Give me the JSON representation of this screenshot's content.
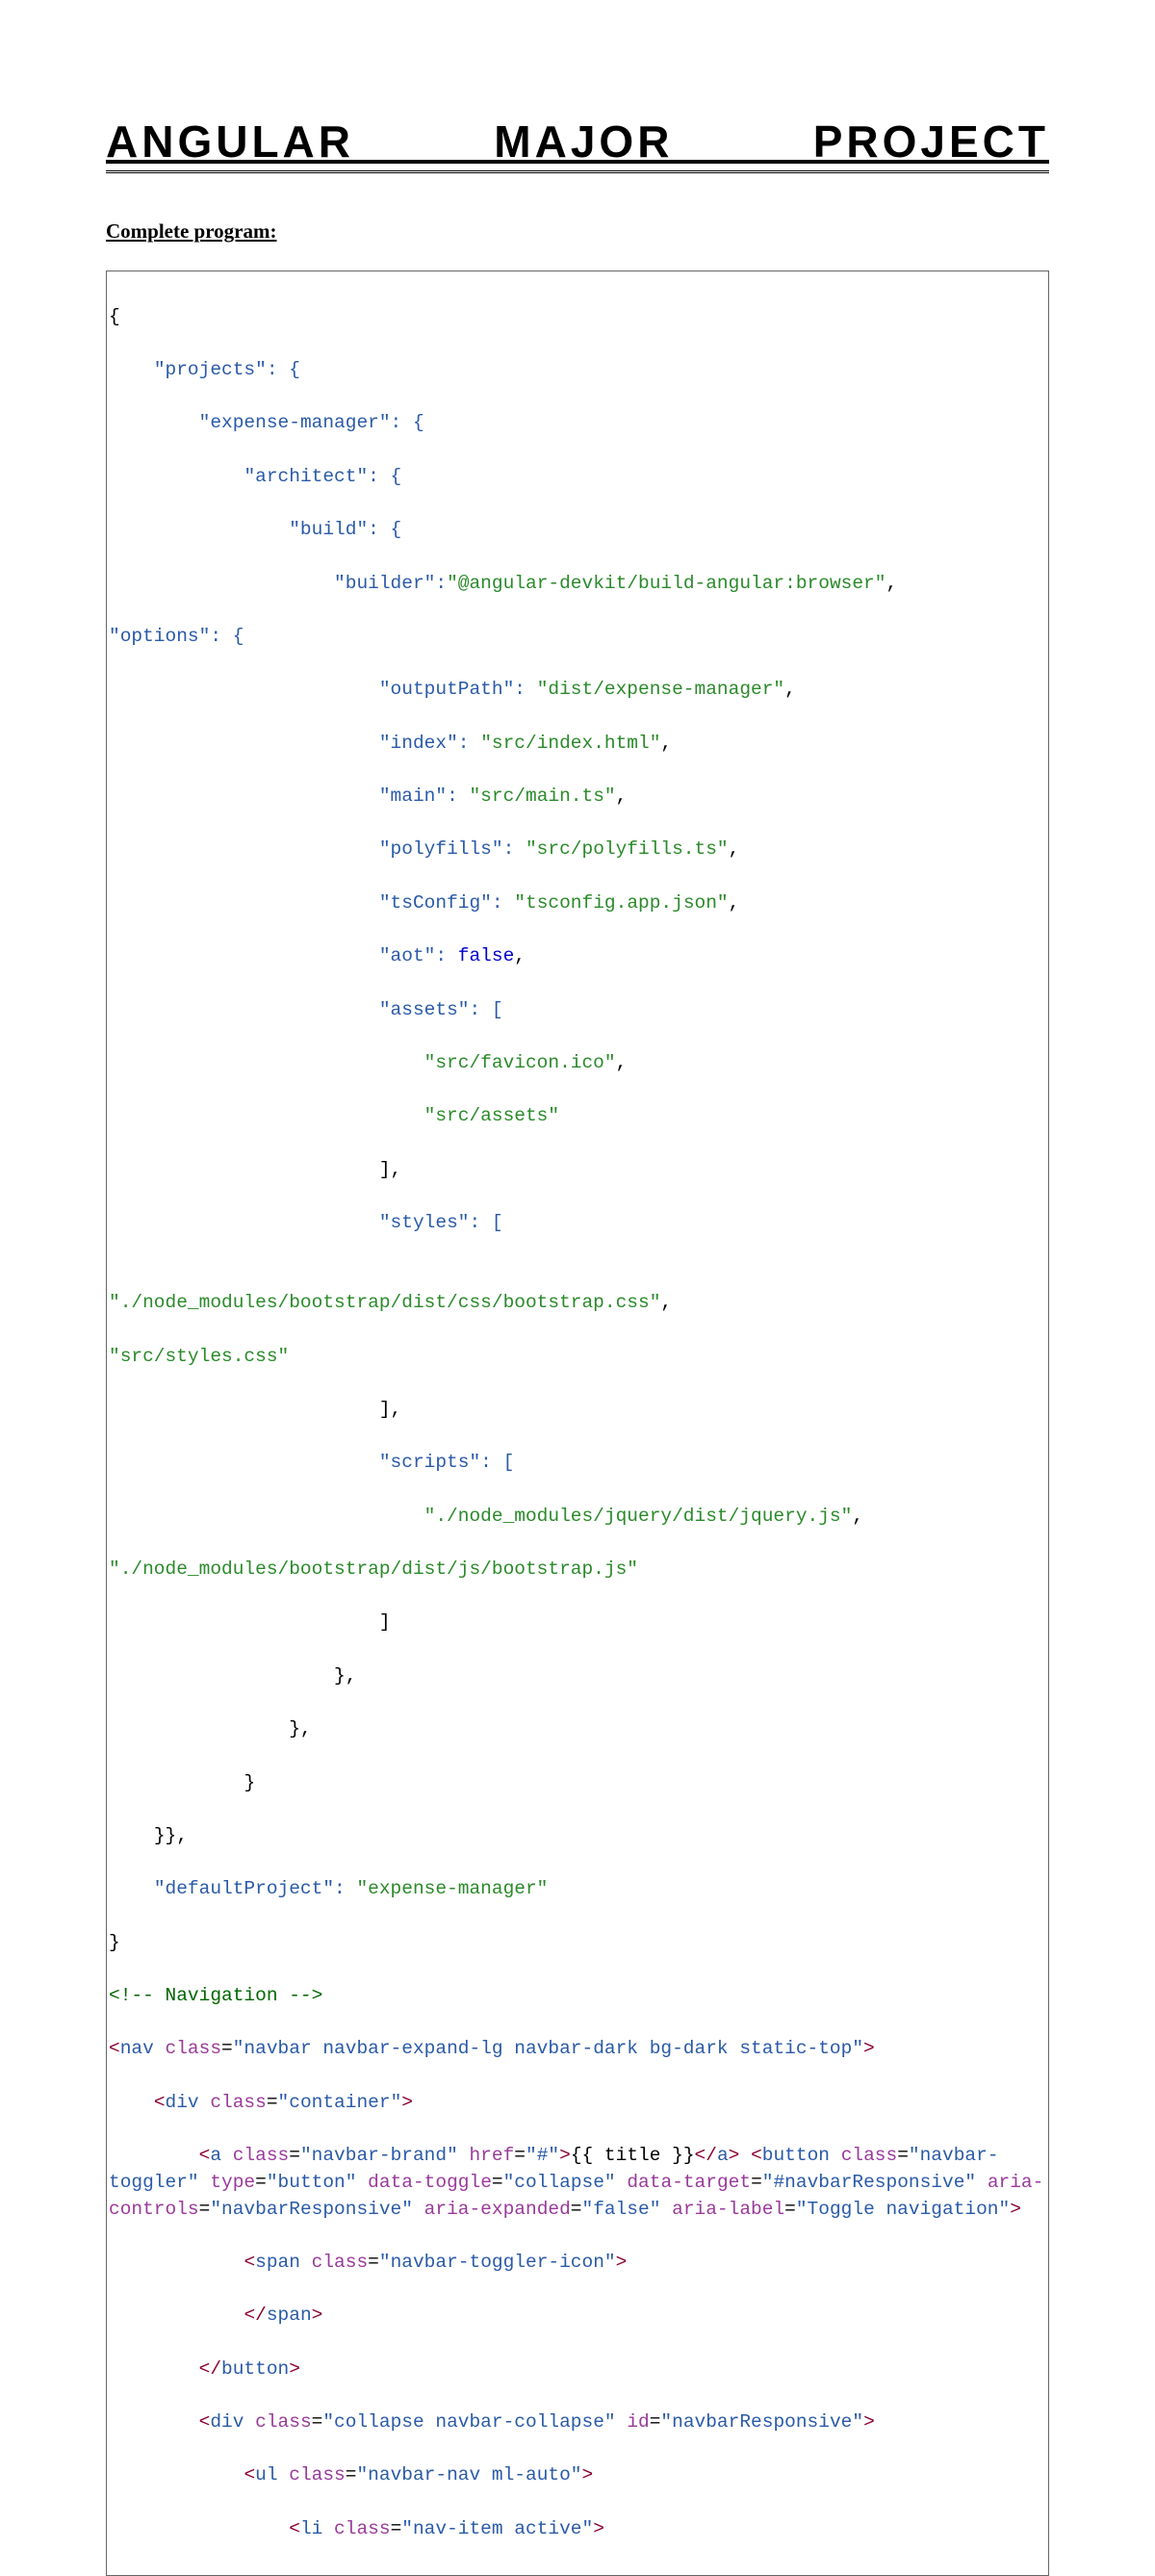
{
  "title": "ANGULAR MAJOR PROJECT",
  "subheading": "Complete program:",
  "code": {
    "json_open_brace": "{",
    "line_projects": "    \"projects\": {",
    "line_em": "        \"expense-manager\": {",
    "line_architect": "            \"architect\": {",
    "line_build": "                \"build\": {",
    "builder_key": "                    \"builder\":",
    "builder_val": "\"@angular-devkit/build-angular:browser\"",
    "comma": ",",
    "options_key": "\"options\": {",
    "outputPath_k": "                        \"outputPath\": ",
    "outputPath_v": "\"dist/expense-manager\"",
    "index_k": "                        \"index\": ",
    "index_v": "\"src/index.html\"",
    "main_k": "                        \"main\": ",
    "main_v": "\"src/main.ts\"",
    "polyfills_k": "                        \"polyfills\": ",
    "polyfills_v": "\"src/polyfills.ts\"",
    "tsConfig_k": "                        \"tsConfig\": ",
    "tsConfig_v": "\"tsconfig.app.json\"",
    "aot_k": "                        \"aot\": ",
    "aot_v": "false",
    "assets_k": "                        \"assets\": [",
    "assets_v1": "                            \"src/favicon.ico\"",
    "assets_v2": "                            \"src/assets\"",
    "close_bracket1": "                        ],",
    "styles_k": "                        \"styles\": [",
    "styles_v1": "\"./node_modules/bootstrap/dist/css/bootstrap.css\"",
    "styles_v2": "\"src/styles.css\"",
    "close_bracket2": "                        ],",
    "scripts_k": "                        \"scripts\": [",
    "scripts_v1": "                            \"./node_modules/jquery/dist/jquery.js\"",
    "scripts_v2": "\"./node_modules/bootstrap/dist/js/bootstrap.js\"",
    "close_bracket3": "                        ]",
    "close_brace1": "                    },",
    "close_brace2": "                },",
    "close_brace3": "            }",
    "close_brace4": "    }},",
    "defaultProject_k": "    \"defaultProject\": ",
    "defaultProject_v": "\"expense-manager\"",
    "json_close_brace": "}",
    "comment_nav": "<!-- Navigation -->",
    "nav_open1": "<",
    "nav_tag": "nav",
    "nav_sp": " ",
    "class_attr": "class",
    "eq": "=",
    "nav_class_v": "\"navbar navbar-expand-lg navbar-dark bg-dark static-top\"",
    "tag_close": ">",
    "div_container_open": "    <",
    "div_tag": "div",
    "div_container_class": "\"container\"",
    "a_open": "        <",
    "a_tag": "a",
    "a_class_v": "\"navbar-brand\"",
    "href_attr": "href",
    "href_v": "\"#\"",
    "a_text": "{{ title }}",
    "a_close_open": "</",
    "button_tag": "button",
    "button_class_v": "\"navbar-toggler\"",
    "type_attr": "type",
    "type_v": "\"button\"",
    "datatoggle_attr": "data-toggle",
    "datatoggle_v": "\"collapse\"",
    "datatarget_attr": "data-target",
    "datatarget_v": "\"#navbarResponsive\"",
    "ariacontrols_attr": "aria-controls",
    "ariacontrols_v": "\"navbarResponsive\"",
    "ariaexpanded_attr": "aria-expanded",
    "ariaexpanded_v": "\"false\"",
    "arialabel_attr": "aria-label",
    "arialabel_v": "\"Toggle navigation\"",
    "span_open": "            <",
    "span_tag": "span",
    "span_class_v": "\"navbar-toggler-icon\"",
    "span_close": "            </",
    "button_close": "        </",
    "div_collapse_open": "        <",
    "div_collapse_class": "\"collapse navbar-collapse\"",
    "id_attr": "id",
    "id_v": "\"navbarResponsive\"",
    "ul_open": "            <",
    "ul_tag": "ul",
    "ul_class_v": "\"navbar-nav ml-auto\"",
    "li_open": "                <",
    "li_tag": "li",
    "li_class_v": "\"nav-item active\""
  }
}
